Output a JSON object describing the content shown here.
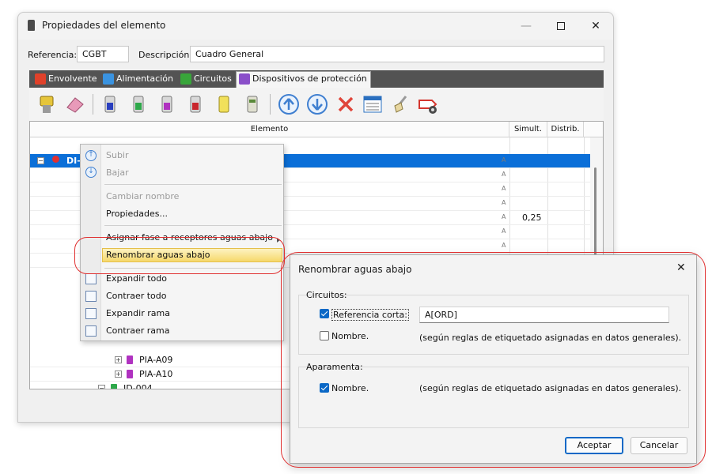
{
  "window": {
    "title": "Propiedades del elemento",
    "minimize_glyph": "—",
    "close_glyph": "✕"
  },
  "fields": {
    "referencia_label": "Referencia:",
    "referencia_value": "CGBT",
    "descripcion_label": "Descripción:",
    "descripcion_value": "Cuadro General"
  },
  "tabs": [
    {
      "label": "Envolvente",
      "icon": "envelope-icon",
      "color": "#e0412a"
    },
    {
      "label": "Alimentación",
      "icon": "supply-icon",
      "color": "#3a93e0"
    },
    {
      "label": "Circuitos",
      "icon": "circuits-icon",
      "color": "#38a53a"
    },
    {
      "label": "Dispositivos de protección",
      "icon": "protection-devices-icon",
      "color": "#8a4fc9",
      "active": true
    }
  ],
  "grid": {
    "col_elemento": "Elemento",
    "col_simult": "Simult.",
    "col_distrib": "Distrib.",
    "a_marker": "A",
    "selected_row_label": "DI-",
    "simult_value": "0,25",
    "tree_rows": [
      {
        "label": "PIA-A09"
      },
      {
        "label": "PIA-A10"
      },
      {
        "label": "ID-004"
      }
    ]
  },
  "context_menu": {
    "items": [
      {
        "label": "Subir",
        "disabled": true,
        "icon": "arrow-up-icon"
      },
      {
        "label": "Bajar",
        "disabled": true,
        "icon": "arrow-down-icon"
      },
      {
        "label": "Cambiar nombre",
        "disabled": true
      },
      {
        "label": "Propiedades..."
      },
      {
        "label": "Asignar fase a receptores aguas abajo",
        "submenu": true
      },
      {
        "label": "Renombrar aguas abajo",
        "highlighted": true
      },
      {
        "label": "Expandir todo",
        "icon": "expand-all-icon"
      },
      {
        "label": "Contraer todo",
        "icon": "collapse-all-icon"
      },
      {
        "label": "Expandir rama",
        "icon": "expand-branch-icon"
      },
      {
        "label": "Contraer rama",
        "icon": "collapse-branch-icon"
      }
    ]
  },
  "dialog": {
    "title": "Renombrar aguas abajo",
    "close_glyph": "✕",
    "circuitos": {
      "label": "Circuitos:",
      "ref_corta_label": "Referencia corta:",
      "ref_corta_checked": true,
      "ref_corta_value": "A[ORD]",
      "nombre_label": "Nombre.",
      "nombre_checked": false,
      "nombre_hint": "(según reglas de etiquetado asignadas en datos generales)."
    },
    "aparamenta": {
      "label": "Aparamenta:",
      "nombre_label": "Nombre.",
      "nombre_checked": true,
      "nombre_hint": "(según reglas de etiquetado asignadas en datos generales)."
    },
    "accept_label": "Aceptar",
    "cancel_label": "Cancelar"
  },
  "colors": {
    "selection": "#0b6fd8",
    "highlight_ring": "#e03030",
    "tabbar": "#535353"
  }
}
